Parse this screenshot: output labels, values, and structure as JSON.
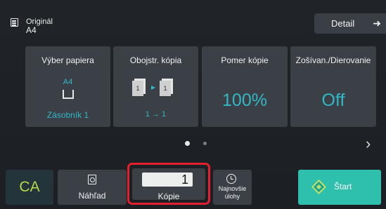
{
  "header": {
    "original_label": "Originál",
    "original_value": "A4",
    "detail_label": "Detail",
    "detail_arrow": "➜"
  },
  "tiles": [
    {
      "title": "Výber papiera",
      "size": "A4",
      "tray": "Zásobník 1"
    },
    {
      "title": "Obojstr. kópia",
      "mode": "1 → 1"
    },
    {
      "title": "Pomer kópie",
      "value": "100%"
    },
    {
      "title": "Zošívan./Dierovanie",
      "value": "Off"
    }
  ],
  "pager": {
    "next_arrow": "›"
  },
  "bottom": {
    "ca_label": "CA",
    "preview_label": "Náhľad",
    "copies_value": "1",
    "copies_label": "Kópie",
    "recent_label_1": "Najnovšie",
    "recent_label_2": "úlohy",
    "start_label": "Štart"
  },
  "colors": {
    "accent_cyan": "#32b7c6",
    "ca_green": "#b7d64a",
    "start_teal": "#2ec0ac",
    "highlight_red": "#e3202c"
  }
}
